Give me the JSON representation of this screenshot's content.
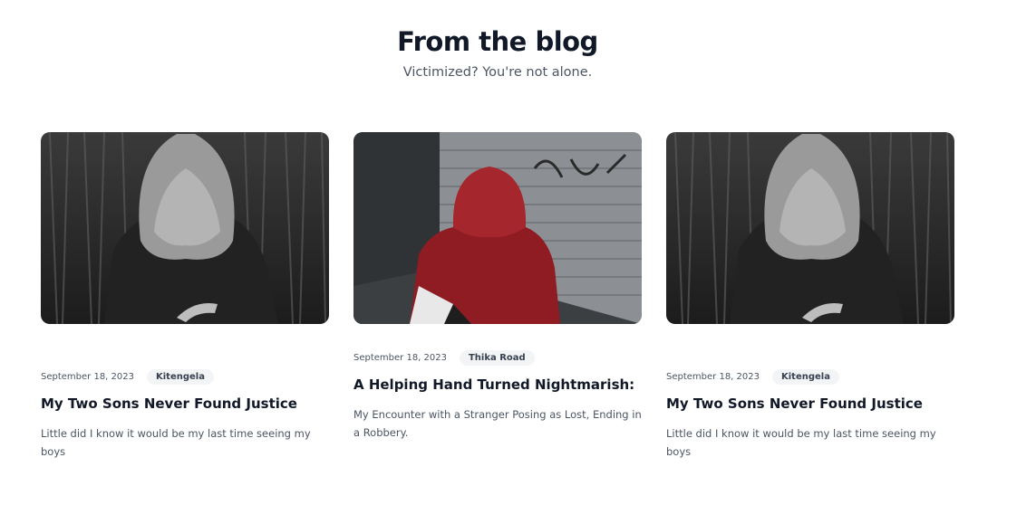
{
  "section": {
    "title": "From the blog",
    "subtitle": "Victimized? You're not alone."
  },
  "posts": [
    {
      "date": "September 18, 2023",
      "tag": "Kitengela",
      "title": "My Two Sons Never Found Justice",
      "excerpt": "Little did I know it would be my last time seeing my boys",
      "image": "hooded-figure-forest-photo"
    },
    {
      "date": "September 18, 2023",
      "tag": "Thika Road",
      "title": "A Helping Hand Turned Nightmarish:",
      "excerpt": "My Encounter with a Stranger Posing as Lost, Ending in a Robbery.",
      "image": "red-hoodie-street-photo"
    },
    {
      "date": "September 18, 2023",
      "tag": "Kitengela",
      "title": "My Two Sons Never Found Justice",
      "excerpt": "Little did I know it would be my last time seeing my boys",
      "image": "hooded-figure-forest-photo"
    }
  ]
}
